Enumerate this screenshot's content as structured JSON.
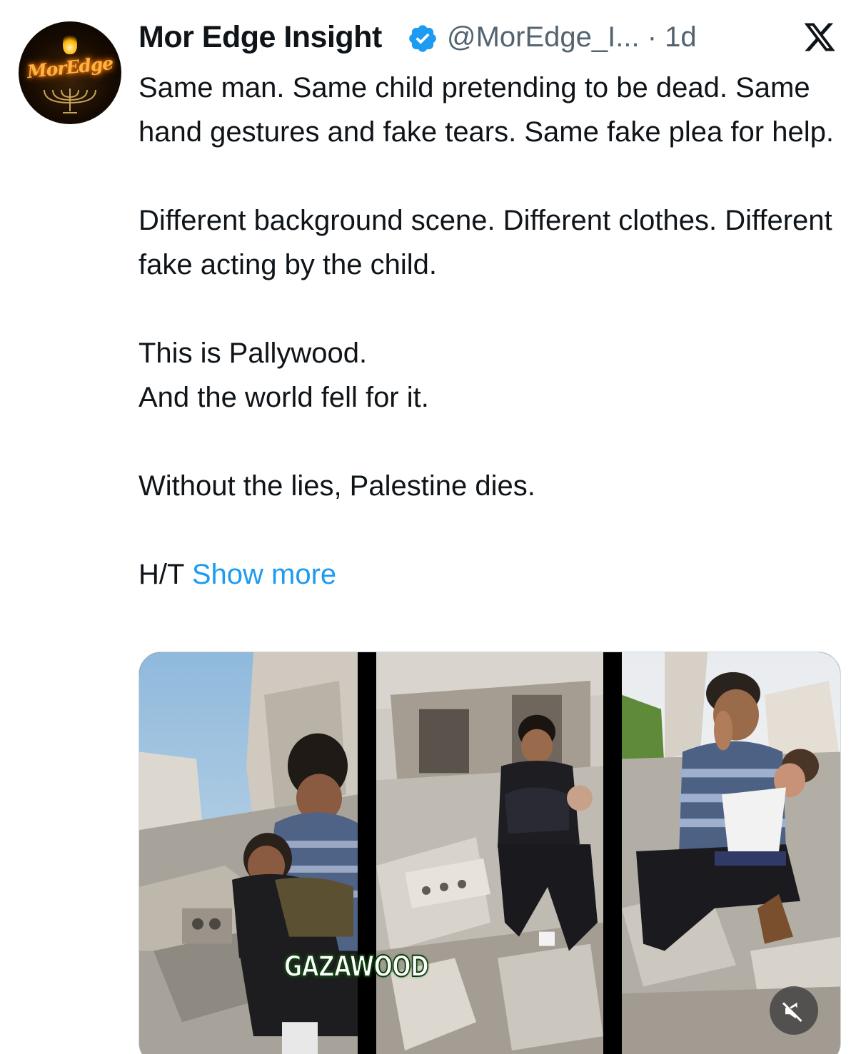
{
  "author": {
    "display_name": "Mor Edge Insight",
    "handle": "@MorEdge_I...",
    "time_separator": " · ",
    "time": "1d",
    "verified": true,
    "avatar_logo_text": "MorEdge"
  },
  "platform_icon": "x-logo-icon",
  "body": {
    "p1": "Same man. Same child pretending to be dead. Same hand gestures and fake tears. Same fake plea for help.",
    "p2": "Different background scene. Different clothes. Different fake acting by the child.",
    "p3_line1": "This is Pallywood.",
    "p3_line2": "And the world fell for it.",
    "p4": "Without the lies, Palestine dies.",
    "p5_prefix": "H/T ",
    "show_more": "Show more"
  },
  "media": {
    "caption": "GAZAWOOD",
    "mute_icon": "muted-speaker-icon"
  },
  "colors": {
    "text": "#0f1419",
    "secondary": "#536471",
    "link": "#1d9bf0",
    "verified": "#1d9bf0"
  }
}
